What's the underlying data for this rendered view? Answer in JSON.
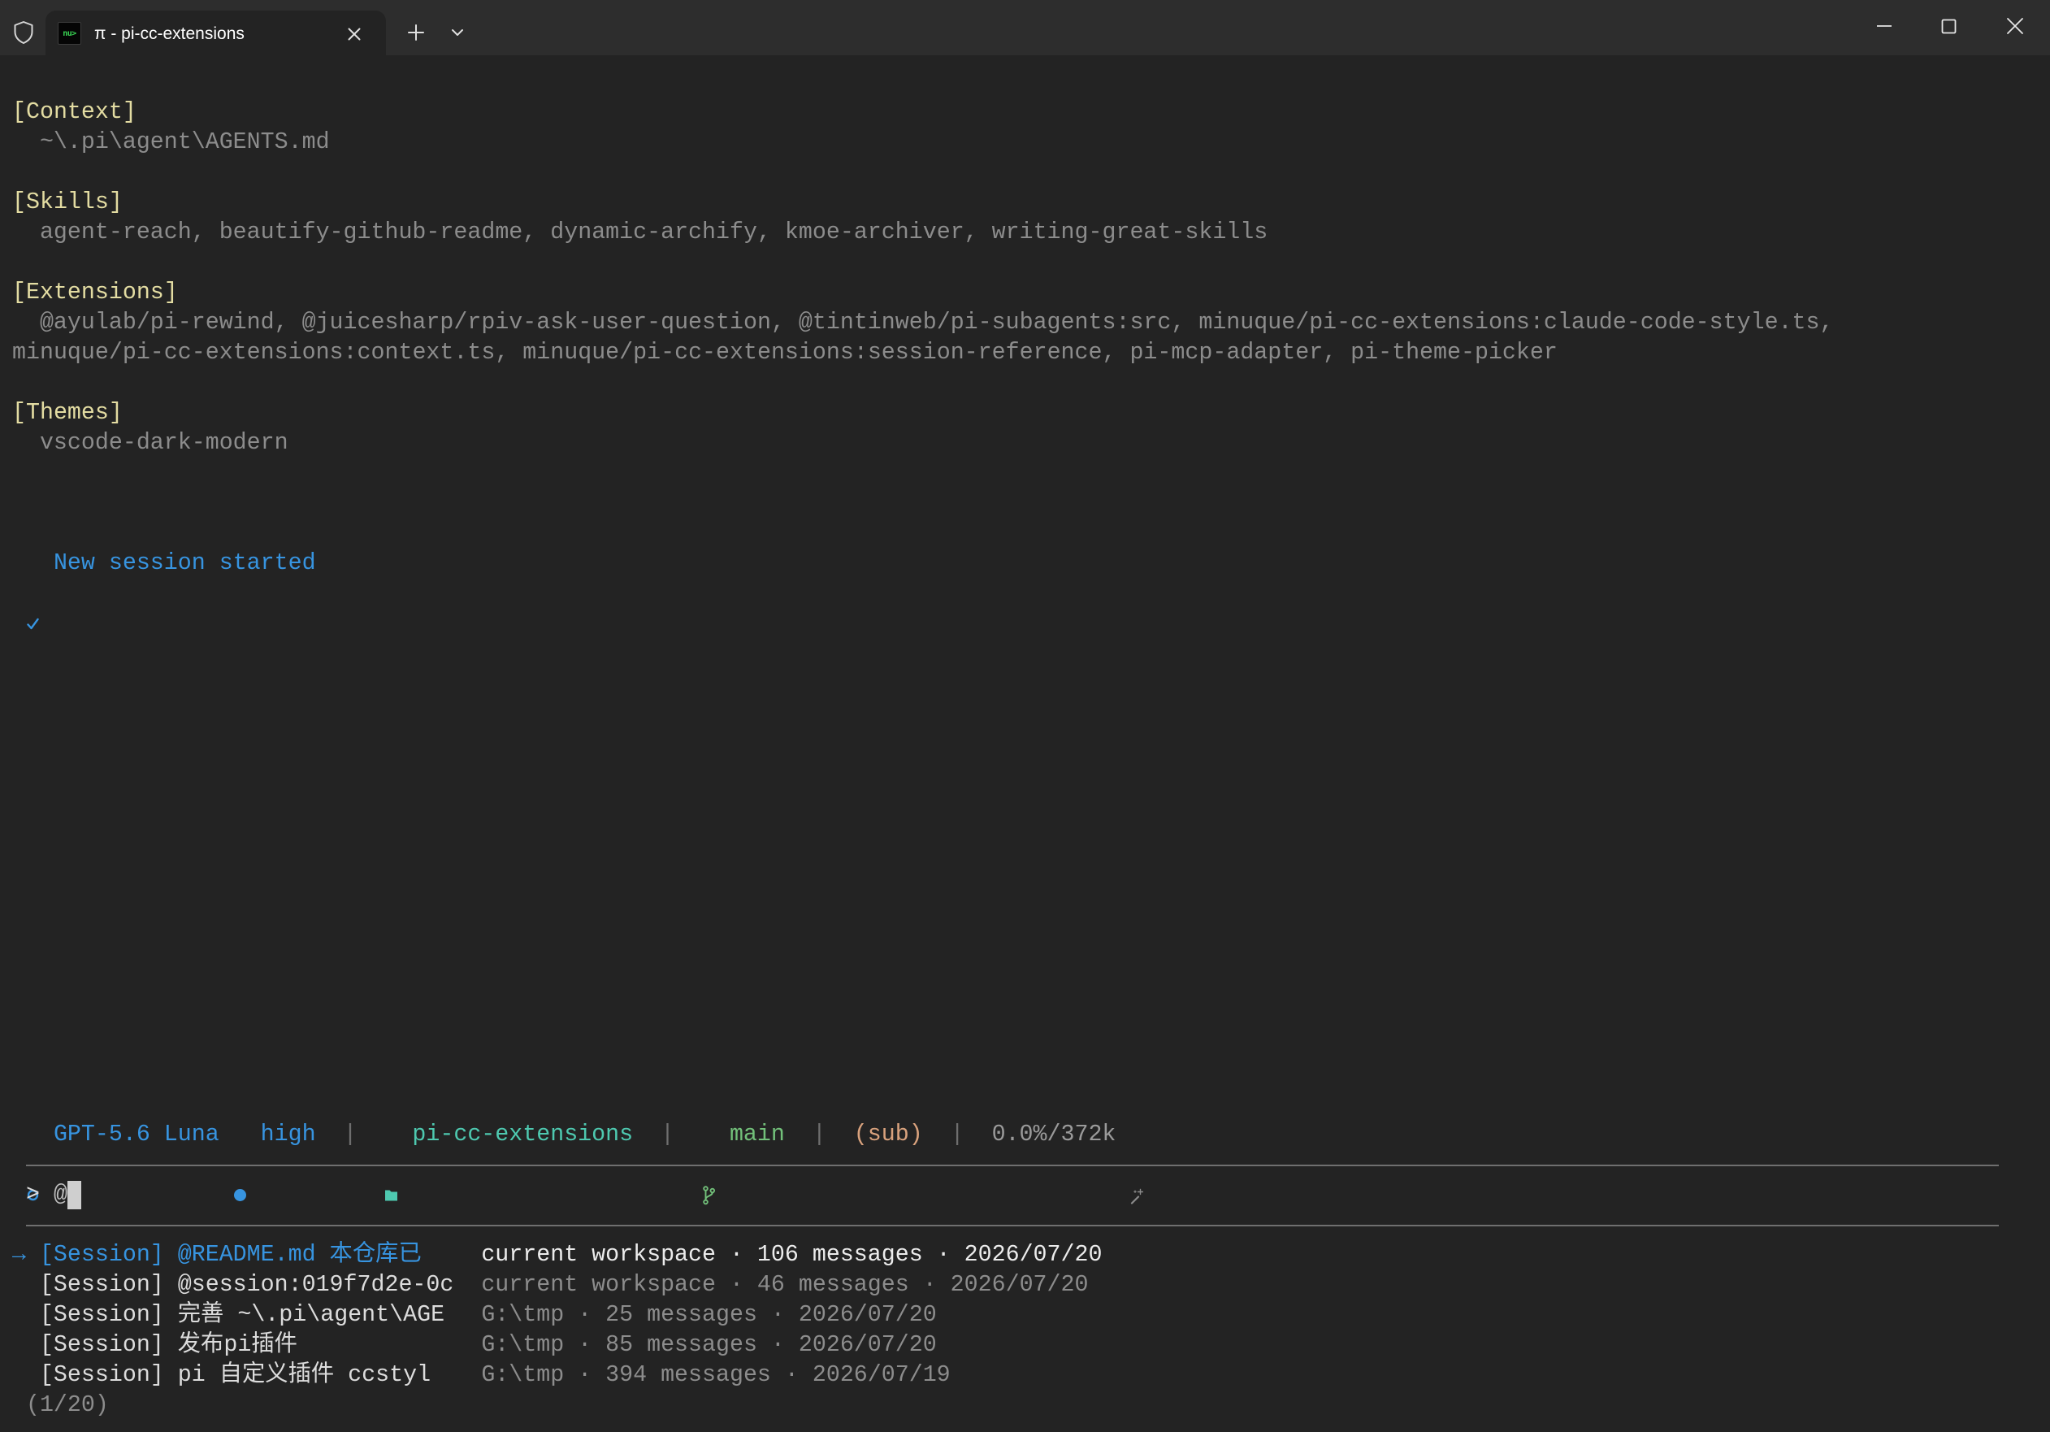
{
  "window": {
    "tab_icon_text": "nu>",
    "tab_title": "π - pi-cc-extensions"
  },
  "terminal": {
    "context": {
      "header": "[Context]",
      "path": "~\\.pi\\agent\\AGENTS.md"
    },
    "skills": {
      "header": "[Skills]",
      "list": "agent-reach, beautify-github-readme, dynamic-archify, kmoe-archiver, writing-great-skills"
    },
    "extensions": {
      "header": "[Extensions]",
      "lines": [
        "@ayulab/pi-rewind, @juicesharp/rpiv-ask-user-question, @tintinweb/pi-subagents:src, minuque/pi-cc-extensions:claude-code-style.ts,",
        "minuque/pi-cc-extensions:context.ts, minuque/pi-cc-extensions:session-reference, pi-mcp-adapter, pi-theme-picker"
      ]
    },
    "themes": {
      "header": "[Themes]",
      "value": "vscode-dark-modern"
    },
    "notice": "New session started"
  },
  "status_bar": {
    "model": "GPT-5.6 Luna",
    "thinking_level": "high",
    "directory": "pi-cc-extensions",
    "branch": "main",
    "plan": "(sub)",
    "context_usage": "0.0%/372k",
    "separator": "|"
  },
  "prompt": {
    "symbol": ">",
    "value": "@"
  },
  "autocomplete": {
    "selection_marker": "→",
    "items": [
      {
        "label": "[Session] @README.md 本仓库已",
        "meta": "current workspace · 106 messages · 2026/07/20",
        "selected": true
      },
      {
        "label": "[Session] @session:019f7d2e-0c",
        "meta": "current workspace · 46 messages · 2026/07/20",
        "selected": false
      },
      {
        "label": "[Session] 完善 ~\\.pi\\agent\\AGE",
        "meta": "G:\\tmp · 25 messages · 2026/07/20",
        "selected": false
      },
      {
        "label": "[Session] 发布pi插件",
        "meta": "G:\\tmp · 85 messages · 2026/07/20",
        "selected": false
      },
      {
        "label": "[Session] pi 自定义插件 ccstyl",
        "meta": "G:\\tmp · 394 messages · 2026/07/19",
        "selected": false
      }
    ],
    "pager": "(1/20)"
  },
  "icons": {
    "titlebar": "shield-icon",
    "tab": "nushell-icon",
    "notice": "check-icon",
    "model": "circle-outline-icon",
    "thinking": "filled-dot-icon",
    "directory": "folder-icon",
    "branch": "git-branch-icon",
    "usage": "magic-wand-icon"
  },
  "colors": {
    "terminal_bg": "#232323",
    "titlebar_bg": "#2d2d2d",
    "section_header": "#e3dca2",
    "accent_blue": "#3794e0",
    "directory": "#4ec9b0",
    "branch": "#72c07a",
    "plan": "#d9a27d",
    "muted": "#8c8c8c"
  }
}
